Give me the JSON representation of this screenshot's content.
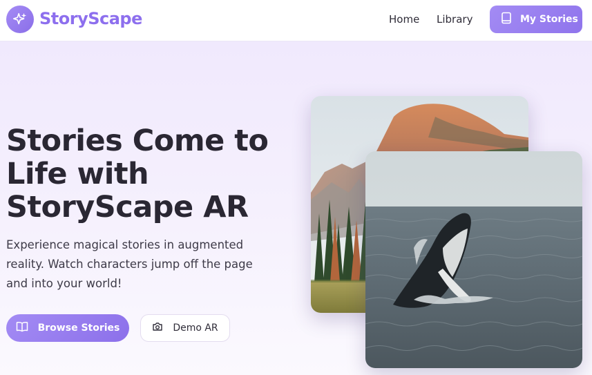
{
  "brand": {
    "name": "StoryScape"
  },
  "nav": {
    "links": [
      "Home",
      "Library"
    ],
    "cta_label": "My Stories"
  },
  "hero": {
    "headline": "Stories Come to Life with StoryScape AR",
    "subtitle": "Experience magical stories in augmented reality. Watch characters jump off the page and into your world!",
    "primary_button": "Browse Stories",
    "secondary_button": "Demo AR"
  },
  "images": {
    "back": "mountain-landscape-photo",
    "front": "humpback-whale-breaching-photo"
  },
  "colors": {
    "accent": "#8d6fee",
    "accent_light": "#a38bf4",
    "background": "#efe7fd",
    "text": "#2a2733"
  }
}
